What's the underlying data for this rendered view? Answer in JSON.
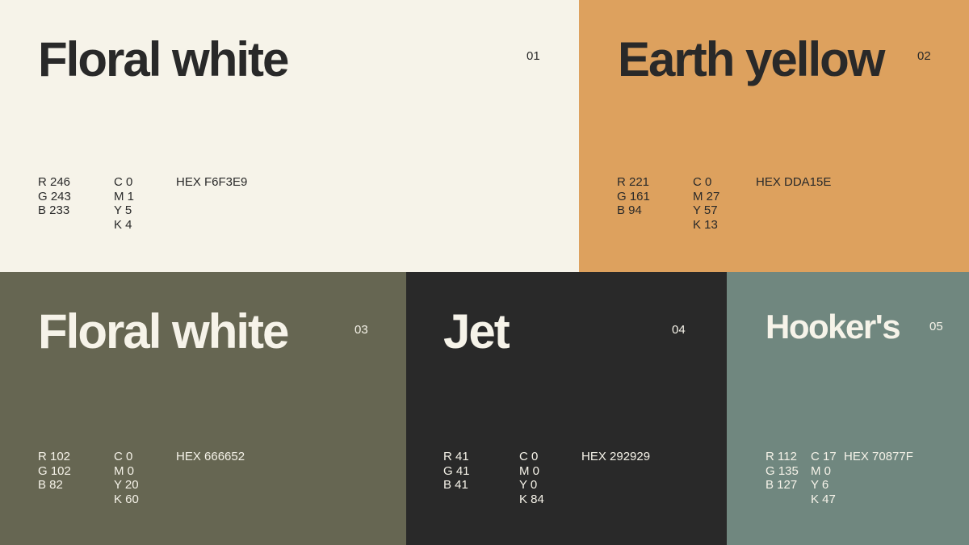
{
  "swatches": [
    {
      "name": "Floral white",
      "number": "01",
      "bg": "#F6F3E9",
      "fg": "#292929",
      "rgb": [
        "R 246",
        "G 243",
        "B 233"
      ],
      "cmyk": [
        "C 0",
        "M 1",
        "Y 5",
        "K 4"
      ],
      "hex": "HEX F6F3E9"
    },
    {
      "name": "Earth yellow",
      "number": "02",
      "bg": "#DDA15E",
      "fg": "#292929",
      "rgb": [
        "R 221",
        "G 161",
        "B 94"
      ],
      "cmyk": [
        "C 0",
        "M 27",
        "Y 57",
        "K 13"
      ],
      "hex": "HEX DDA15E"
    },
    {
      "name": "Floral white",
      "number": "03",
      "bg": "#666652",
      "fg": "#F6F3E9",
      "rgb": [
        "R 102",
        "G 102",
        "B 82"
      ],
      "cmyk": [
        "C 0",
        "M 0",
        "Y 20",
        "K 60"
      ],
      "hex": "HEX 666652"
    },
    {
      "name": "Jet",
      "number": "04",
      "bg": "#292929",
      "fg": "#F6F3E9",
      "rgb": [
        "R 41",
        "G 41",
        "B 41"
      ],
      "cmyk": [
        "C 0",
        "M 0",
        "Y 0",
        "K 84"
      ],
      "hex": "HEX 292929"
    },
    {
      "name": "Hooker's",
      "number": "05",
      "bg": "#70877F",
      "fg": "#F6F3E9",
      "rgb": [
        "R 112",
        "G 135",
        "B 127"
      ],
      "cmyk": [
        "C 17",
        "M 0",
        "Y 6",
        "K 47"
      ],
      "hex": "HEX 70877F"
    }
  ]
}
